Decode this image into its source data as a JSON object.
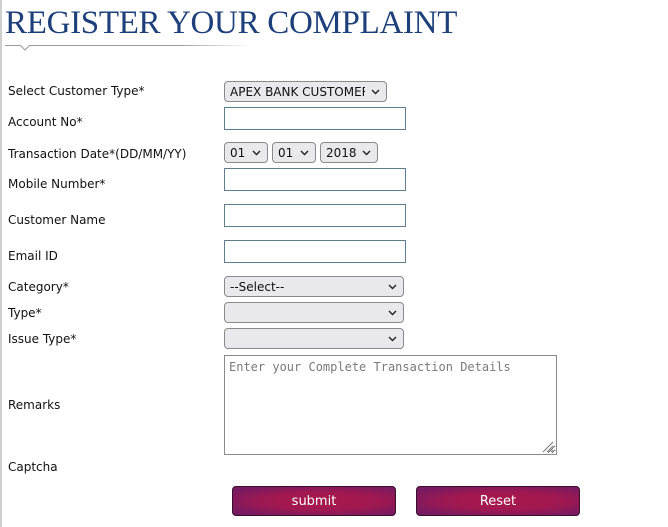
{
  "header": {
    "title": "REGISTER YOUR COMPLAINT"
  },
  "form": {
    "customer_type": {
      "label": "Select Customer Type*",
      "value": "APEX BANK CUSTOMER"
    },
    "account_no": {
      "label": "Account No*",
      "value": ""
    },
    "transaction_date": {
      "label": "Transaction Date*(DD/MM/YY)",
      "day": "01",
      "month": "01",
      "year": "2018"
    },
    "mobile_number": {
      "label": "Mobile Number*",
      "value": ""
    },
    "customer_name": {
      "label": "Customer Name",
      "value": ""
    },
    "email_id": {
      "label": "Email ID",
      "value": ""
    },
    "category": {
      "label": "Category*",
      "value": "--Select--"
    },
    "type": {
      "label": "Type*",
      "value": ""
    },
    "issue_type": {
      "label": "Issue Type*",
      "value": ""
    },
    "remarks": {
      "label": "Remarks",
      "placeholder": "Enter your Complete Transaction Details",
      "value": ""
    },
    "captcha": {
      "label": "Captcha"
    }
  },
  "actions": {
    "submit_label": "submit",
    "reset_label": "Reset"
  },
  "colors": {
    "title": "#1d3f7a",
    "button_primary": "#a8174c",
    "button_edge": "#6e1a66"
  }
}
